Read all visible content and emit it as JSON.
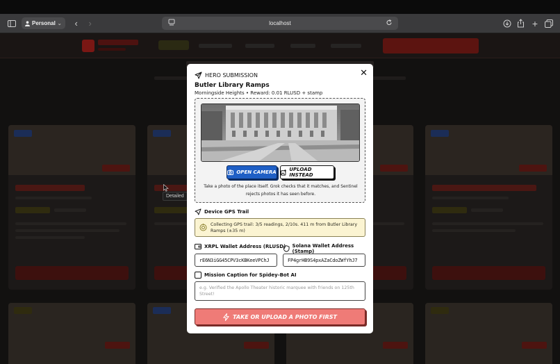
{
  "browser": {
    "profile_label": "Personal",
    "url": "localhost"
  },
  "tooltip": "Detailed",
  "modal": {
    "header": "HERO SUBMISSION",
    "title": "Butler Library Ramps",
    "subtitle": "Morningside Heights • Reward: 0.01 RLUSD + stamp",
    "open_camera": "OPEN CAMERA",
    "upload_instead": "UPLOAD INSTEAD",
    "photo_help": "Take a photo of the place itself. Grok checks that it matches, and Sentinel rejects photos it has seen before.",
    "gps_section": "Device GPS Trail",
    "gps_status": "Collecting GPS trail: 3/5 readings, 2/10s. 411 m from Butler Library Ramps (±35 m)",
    "xrpl_label": "XRPL Wallet Address (RLUSD)",
    "xrpl_value": "rE6N3iGG45CPV3cKBKeeVPChJ",
    "solana_label": "Solana Wallet Address (Stamp)",
    "solana_value": "FP4grHB9S4pxAZaCdoZWfYhJ7",
    "caption_label": "Mission Caption for Spidey-Bot AI",
    "caption_placeholder": "e.g. Verified the Apollo Theater historic marquee with friends on 125th Street!",
    "submit_label": "TAKE OR UPLOAD A PHOTO FIRST"
  },
  "icons": {
    "header": "paper-plane-icon",
    "close": "close-icon",
    "camera": "camera-icon",
    "upload": "image-upload-icon",
    "gps": "navigation-arrow-icon",
    "gps_status": "location-ring-icon",
    "wallet": "wallet-icon",
    "shield": "shield-icon",
    "checkbox": "checkbox-icon",
    "submit": "lightning-icon"
  },
  "colors": {
    "camera_button": "#1f5fc5",
    "submit_button": "#ef7b77",
    "gps_box": "#fbf4d2"
  }
}
